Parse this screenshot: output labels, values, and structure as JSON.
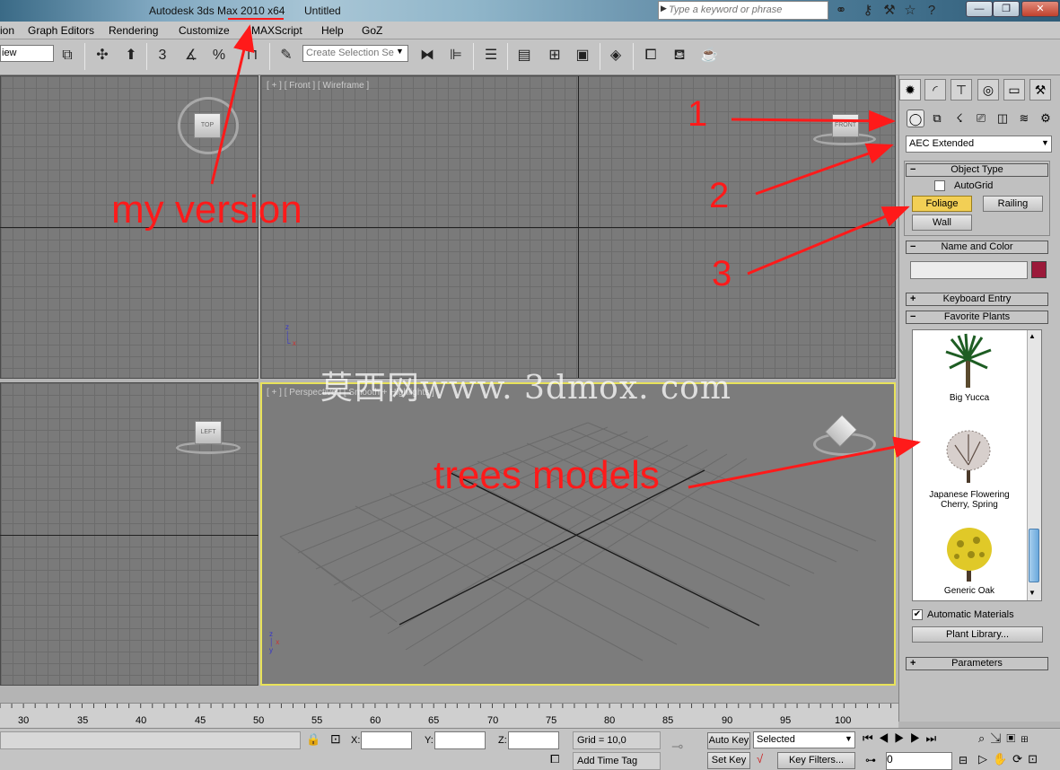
{
  "window": {
    "title": "Autodesk 3ds Max  2010 x64",
    "file": "Untitled",
    "search_placeholder": "Type a keyword or phrase"
  },
  "menu": [
    "ion",
    "Graph Editors",
    "Rendering",
    "Customize",
    "MAXScript",
    "Help",
    "GoZ"
  ],
  "toolbar": {
    "view_select": "iew",
    "selection_set_placeholder": "Create Selection Se",
    "snap_label": "3"
  },
  "viewports": {
    "top_label": "TOP",
    "front_label": "[ + ] [ Front ] [ Wireframe ]",
    "front_cube": "FRONT",
    "left_label": "LEFT",
    "persp_label": "[ + ] [ Perspective ] [ Smooth + Highlights ]"
  },
  "command_panel": {
    "category_select": "AEC Extended",
    "object_type": {
      "title": "Object Type",
      "autogrid": "AutoGrid",
      "buttons": [
        "Foliage",
        "Railing",
        "Wall"
      ]
    },
    "name_and_color": {
      "title": "Name and Color",
      "name_value": "",
      "color": "#9b1a3a"
    },
    "keyboard_entry": "Keyboard Entry",
    "favorite_plants": {
      "title": "Favorite Plants",
      "plants": [
        "Big Yucca",
        "Japanese Flowering Cherry, Spring",
        "Generic Oak"
      ]
    },
    "automatic_materials": "Automatic Materials",
    "plant_library": "Plant Library...",
    "parameters": "Parameters"
  },
  "timeline": {
    "ticks": [
      "30",
      "35",
      "40",
      "45",
      "50",
      "55",
      "60",
      "65",
      "70",
      "75",
      "80",
      "85",
      "90",
      "95",
      "100"
    ]
  },
  "status": {
    "x_label": "X:",
    "y_label": "Y:",
    "z_label": "Z:",
    "grid": "Grid = 10,0",
    "auto_key": "Auto Key",
    "set_key": "Set Key",
    "selected": "Selected",
    "key_filters": "Key Filters...",
    "add_time_tag": "Add Time Tag",
    "frame": "0"
  },
  "annotations": {
    "version": "my version",
    "n1": "1",
    "n2": "2",
    "n3": "3",
    "trees": "trees models",
    "watermark": "莫西网www. 3dmox. com"
  },
  "colors": {
    "annotation": "#ff1a1a",
    "active_viewport": "#e8e25a",
    "foliage_button": "#f2cf55"
  }
}
